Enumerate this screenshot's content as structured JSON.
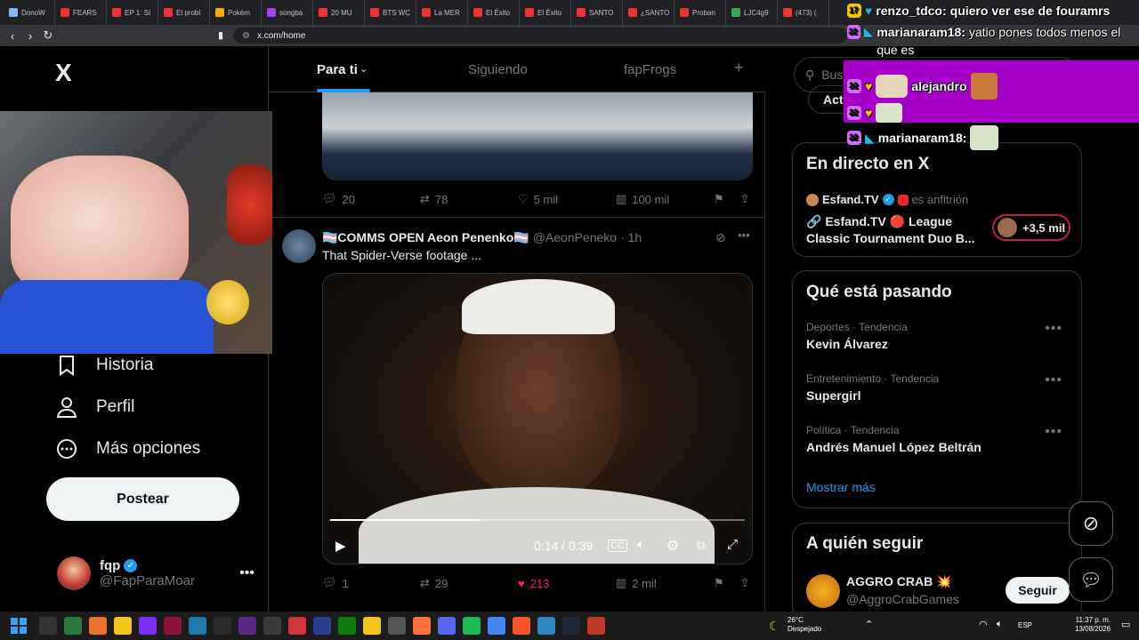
{
  "browser": {
    "tabs": [
      "DonoW",
      "FEARS",
      "EP 1: SI",
      "El probl",
      "Pokém",
      "songba",
      "20 MU",
      "BTS WC",
      "La MER",
      "El Éxito",
      "El Éxito",
      "SANTO",
      "¿SANTO",
      "Proban",
      "LJC4g9",
      "(473) ("
    ],
    "url": "x.com/home"
  },
  "sidebar": {
    "logo": "X",
    "items": [
      "Historia",
      "Perfil",
      "Más opciones"
    ],
    "post_label": "Postear",
    "account": {
      "name": "fqp",
      "handle": "@FapParaMoar"
    }
  },
  "feed": {
    "tabs": [
      "Para ti",
      "Siguiendo",
      "fapFrogs"
    ],
    "tweet1_actions": {
      "replies": "20",
      "reposts": "78",
      "likes": "5 mil",
      "views": "100 mil"
    },
    "tweet2": {
      "name": "🏳️‍⚧️COMMS OPEN Aeon Penenko🏳️‍⚧️",
      "handle": "@AeonPeneko",
      "time": "· 1h",
      "text": "That Spider-Verse footage ...",
      "video_time": "0:14 / 0:39",
      "video_progress": 0.36,
      "actions": {
        "replies": "1",
        "reposts": "29",
        "likes": "213",
        "views": "2 mil"
      }
    }
  },
  "right": {
    "search_placeholder": "Busc",
    "premium_btn": "Actualizar a Premium",
    "live": {
      "title": "En directo en X",
      "host_name": "Esfand.TV",
      "host_suffix": "es anfitrión",
      "space_title": "🔗 Esfand.TV 🔴 League Classic Tournament Duo B...",
      "listeners": "+3,5 mil"
    },
    "trends_title": "Qué está pasando",
    "trends": [
      {
        "category": "Deportes · Tendencia",
        "name": "Kevin Álvarez"
      },
      {
        "category": "Entretenimiento · Tendencia",
        "name": "Supergirl"
      },
      {
        "category": "Política · Tendencia",
        "name": "Andrés Manuel López Beltrán"
      }
    ],
    "show_more": "Mostrar más",
    "follow_title": "A quién seguir",
    "suggestion": {
      "name": "AGGRO CRAB 💥",
      "handle": "@AggroCrabGames",
      "button": "Seguir"
    }
  },
  "chat": [
    {
      "badge": "17",
      "user": "renzo_tdco:",
      "msg": "quiero ver ese de fouramrs"
    },
    {
      "badge": "22",
      "user": "marianaram18:",
      "msg": "yatio pones todos menos el que es"
    },
    {
      "badge": "22",
      "user": "",
      "msg": "alejandro"
    },
    {
      "badge": "22",
      "user": "marianaram18:",
      "msg": ""
    }
  ],
  "taskbar": {
    "weather_temp": "26°C",
    "weather_desc": "Despejado",
    "lang": "ESP",
    "time": "11:37 p. m.",
    "date": "13/08/2026"
  },
  "colors": {
    "accent": "#1d9bf0",
    "like": "#f91880",
    "chat_purple": "#a600c8"
  }
}
